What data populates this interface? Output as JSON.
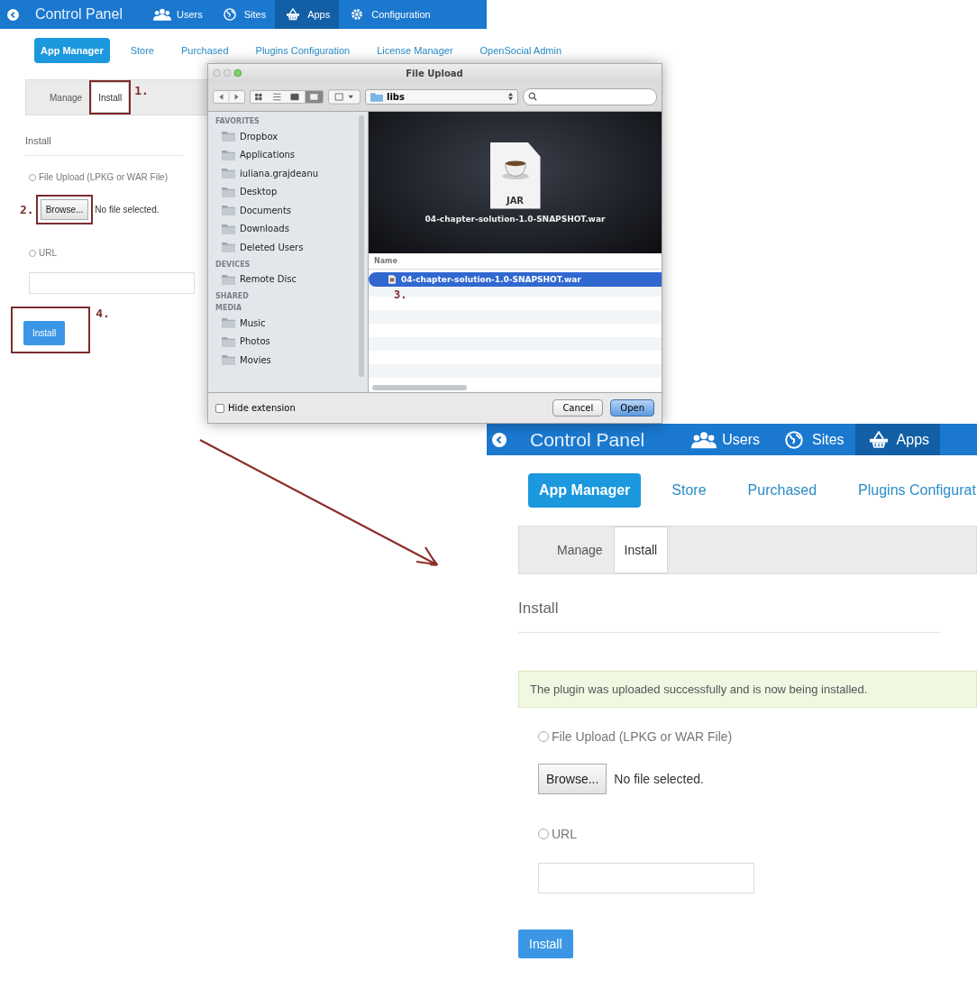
{
  "panels": [
    {
      "kind": "small",
      "top_bar": {
        "title": "Control Panel",
        "nav": [
          {
            "label": "Users",
            "selected": false
          },
          {
            "label": "Sites",
            "selected": false
          },
          {
            "label": "Apps",
            "selected": true
          },
          {
            "label": "Configuration",
            "selected": false
          }
        ]
      },
      "tabs": [
        {
          "label": "App Manager",
          "selected": true
        },
        {
          "label": "Store",
          "selected": false
        },
        {
          "label": "Purchased",
          "selected": false
        },
        {
          "label": "Plugins Configuration",
          "selected": false
        },
        {
          "label": "License Manager",
          "selected": false
        },
        {
          "label": "OpenSocial Admin",
          "selected": false
        }
      ],
      "subtabs": [
        {
          "label": "Manage",
          "selected": false
        },
        {
          "label": "Install",
          "selected": true,
          "callout": "1."
        }
      ],
      "heading": "Install",
      "file_option": {
        "label": "File Upload (LPKG or WAR File)",
        "selected": false
      },
      "browse": {
        "label": "Browse...",
        "status": "No file selected.",
        "callout": "2."
      },
      "url_option": {
        "label": "URL",
        "selected": false
      },
      "install_button": {
        "label": "Install",
        "callout": "4."
      }
    },
    {
      "kind": "large",
      "top_bar": {
        "title": "Control Panel",
        "nav": [
          {
            "label": "Users",
            "selected": false
          },
          {
            "label": "Sites",
            "selected": false
          },
          {
            "label": "Apps",
            "selected": true
          }
        ]
      },
      "tabs": [
        {
          "label": "App Manager",
          "selected": true
        },
        {
          "label": "Store",
          "selected": false
        },
        {
          "label": "Purchased",
          "selected": false
        },
        {
          "label": "Plugins Configurat",
          "selected": false
        }
      ],
      "subtabs": [
        {
          "label": "Manage",
          "selected": false
        },
        {
          "label": "Install",
          "selected": true
        }
      ],
      "heading": "Install",
      "alert": "The plugin was uploaded successfully and is now being installed.",
      "file_option": {
        "label": "File Upload (LPKG or WAR File)",
        "selected": false
      },
      "browse": {
        "label": "Browse...",
        "status": "No file selected."
      },
      "url_option": {
        "label": "URL",
        "selected": false
      },
      "install_button": {
        "label": "Install"
      }
    }
  ],
  "file_dialog": {
    "title": "File Upload",
    "folder": "libs",
    "sidebar": [
      {
        "heading": "FAVORITES",
        "items": [
          "Dropbox",
          "Applications",
          "iuliana.grajdeanu",
          "Desktop",
          "Documents",
          "Downloads",
          "Deleted Users"
        ]
      },
      {
        "heading": "DEVICES",
        "items": [
          "Remote Disc"
        ]
      },
      {
        "heading": "SHARED"
      },
      {
        "heading": "MEDIA",
        "items": [
          "Music",
          "Photos",
          "Movies"
        ]
      }
    ],
    "preview": {
      "badge": "JAR",
      "filename": "04-chapter-solution-1.0-SNAPSHOT.war"
    },
    "column": "Name",
    "files": [
      {
        "name": "04-chapter-solution-1.0-SNAPSHOT.war",
        "selected": true
      }
    ],
    "callout": "3.",
    "hide_extension": {
      "label": "Hide extension",
      "checked": false
    },
    "buttons": [
      {
        "label": "Cancel",
        "default": false
      },
      {
        "label": "Open",
        "default": true
      }
    ]
  }
}
